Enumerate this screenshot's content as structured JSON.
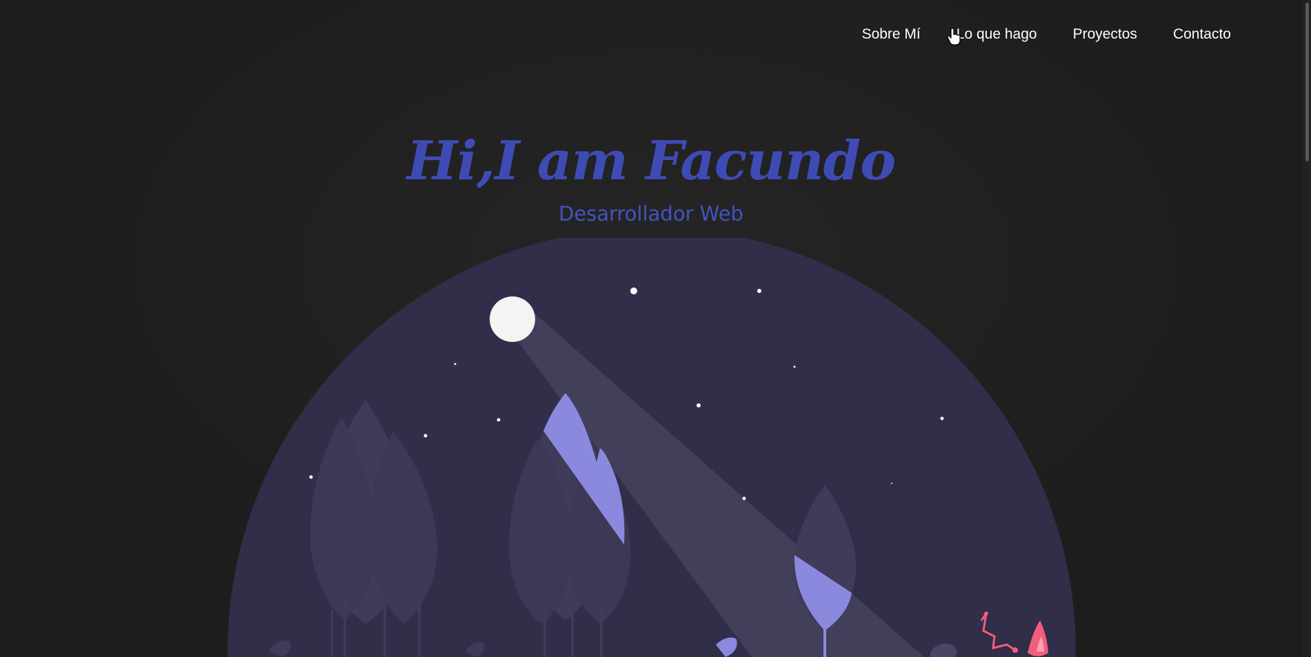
{
  "nav": {
    "items": [
      {
        "label": "Sobre Mí"
      },
      {
        "label": "Lo que hago"
      },
      {
        "label": "Proyectos"
      },
      {
        "label": "Contacto"
      }
    ]
  },
  "hero": {
    "title": "Hi,I am Facundo",
    "subtitle": "Desarrollador Web"
  },
  "colors": {
    "background": "#1e1e1e",
    "accent": "#3f4bb5",
    "illustration_sky": "#302e48",
    "tree": "#3f3b58",
    "highlight": "#8b89de",
    "moon": "#f5f3f3",
    "fire": "#f35d7c"
  }
}
